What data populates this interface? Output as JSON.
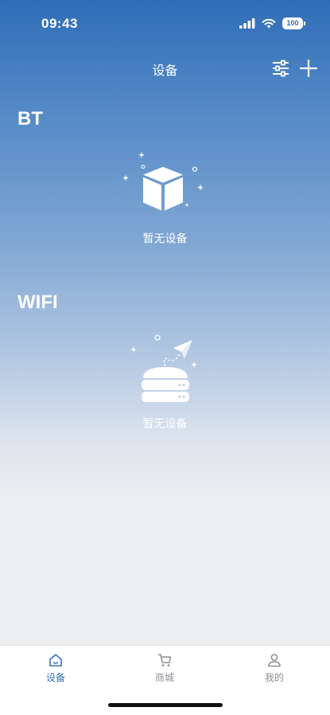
{
  "status_bar": {
    "time": "09:43",
    "battery": "100",
    "signal_icon": "cellular-signal-icon",
    "wifi_icon": "wifi-icon"
  },
  "nav": {
    "title": "设备",
    "filter_icon": "sliders-icon",
    "add_icon": "plus-icon"
  },
  "sections": {
    "bt": {
      "title": "BT",
      "empty_text": "暂无设备",
      "illustration": "cube-box-icon"
    },
    "wifi": {
      "title": "WIFI",
      "empty_text": "暂无设备",
      "illustration": "router-paper-plane-icon"
    }
  },
  "tab_bar": {
    "tabs": [
      {
        "label": "设备",
        "icon": "home-icon",
        "active": true
      },
      {
        "label": "商城",
        "icon": "cart-icon",
        "active": false
      },
      {
        "label": "我的",
        "icon": "user-icon",
        "active": false
      }
    ]
  },
  "colors": {
    "header_blue": "#2f6db8",
    "active_tab": "#3a72c0",
    "inactive_tab": "#8c8f94",
    "background": "#eeeff1"
  }
}
